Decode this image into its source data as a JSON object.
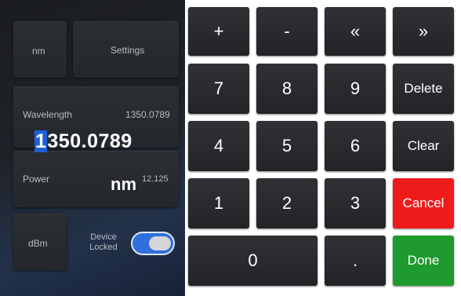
{
  "left_panel": {
    "unit_button": "nm",
    "settings_button": "Settings",
    "wavelength_label": "Wavelength",
    "wavelength_current": "1350.0789",
    "wavelength_entry_cursor": "1",
    "wavelength_entry_rest": "350.0789",
    "power_label": "Power",
    "power_unit": "nm",
    "power_value": "12.125",
    "dbm_button": "dBm",
    "device_locked_label": "Device Locked",
    "device_locked_on": true
  },
  "keypad": {
    "keys": {
      "plus": "+",
      "minus": "-",
      "prev": "«",
      "next": "»",
      "k7": "7",
      "k8": "8",
      "k9": "9",
      "delete": "Delete",
      "k4": "4",
      "k5": "5",
      "k6": "6",
      "clear": "Clear",
      "k1": "1",
      "k2": "2",
      "k3": "3",
      "cancel": "Cancel",
      "k0": "0",
      "dot": ".",
      "done": "Done"
    },
    "colors": {
      "cancel": "#ee1b1b",
      "done": "#1f9a2e",
      "key": "#2a2c2f",
      "cursor": "#1f5fd6"
    }
  }
}
